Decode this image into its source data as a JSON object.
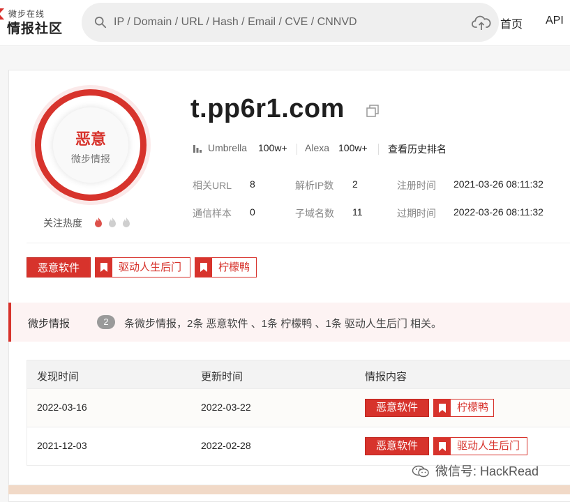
{
  "header": {
    "logo_small": "微步在线",
    "logo_big": "情报社区",
    "search_placeholder": "IP / Domain / URL / Hash / Email / CVE / CNNVD",
    "nav": [
      "首页",
      "API"
    ]
  },
  "verdict": {
    "label": "恶意",
    "source": "微步情报",
    "heat_label": "关注热度",
    "heat_level": 1,
    "heat_max": 3,
    "color": "#d7332c"
  },
  "domain": {
    "name": "t.pp6r1.com",
    "umbrella_label": "Umbrella",
    "umbrella_value": "100w+",
    "alexa_label": "Alexa",
    "alexa_value": "100w+",
    "history_link": "查看历史排名"
  },
  "stats": [
    {
      "label": "相关URL",
      "value": "8"
    },
    {
      "label": "解析IP数",
      "value": "2"
    },
    {
      "label": "注册时间",
      "value": "2021-03-26 08:11:32"
    },
    {
      "label": "通信样本",
      "value": "0"
    },
    {
      "label": "子域名数",
      "value": "11"
    },
    {
      "label": "过期时间",
      "value": "2022-03-26 08:11:32"
    }
  ],
  "tags": [
    {
      "label": "恶意软件",
      "style": "solid"
    },
    {
      "label": "驱动人生后门",
      "style": "outline"
    },
    {
      "label": "柠檬鸭",
      "style": "outline"
    }
  ],
  "intel": {
    "title": "微步情报",
    "count": "2",
    "summary": "条微步情报，2条 恶意软件 、1条 柠檬鸭 、1条 驱动人生后门 相关。"
  },
  "table": {
    "headers": [
      "发现时间",
      "更新时间",
      "情报内容"
    ],
    "rows": [
      {
        "found": "2022-03-16",
        "updated": "2022-03-22",
        "solid_tag": "恶意软件",
        "outline_tag": "柠檬鸭"
      },
      {
        "found": "2021-12-03",
        "updated": "2022-02-28",
        "solid_tag": "恶意软件",
        "outline_tag": "驱动人生后门"
      }
    ]
  },
  "watermark": "微信号: HackRead",
  "icons": [
    "search-icon",
    "cloud-upload-icon",
    "copy-icon",
    "bar-chart-icon",
    "flame-icon",
    "bookmark-icon",
    "wechat-icon"
  ],
  "colors": {
    "accent": "#d7332c",
    "band_bg": "#fdf3f3",
    "muted": "#888888"
  }
}
